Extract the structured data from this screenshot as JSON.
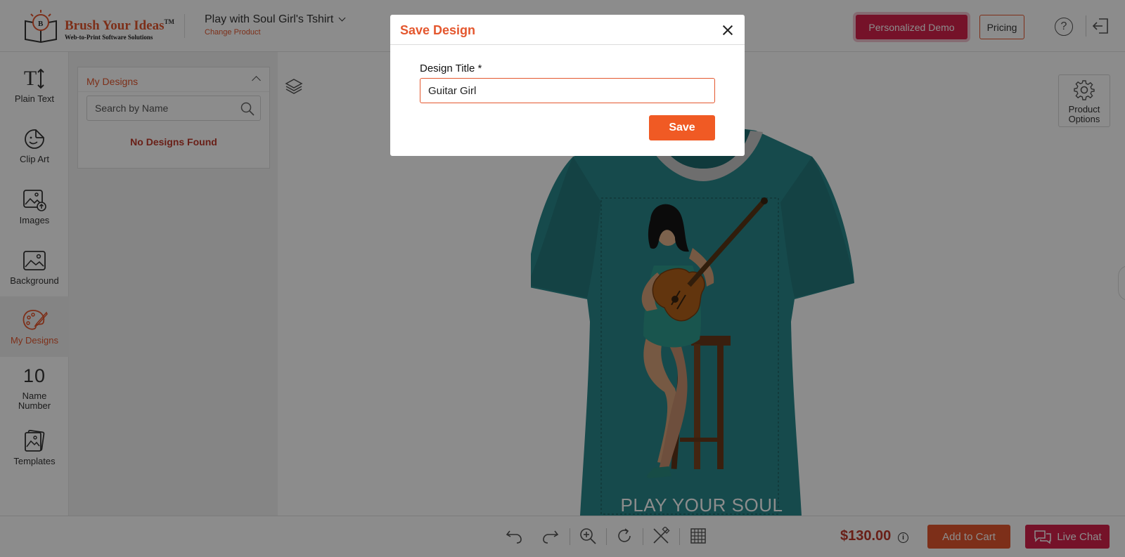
{
  "header": {
    "brand_name": "Brush Your Ideas",
    "brand_tm": "TM",
    "brand_tagline": "Web-to-Print Software Solutions",
    "product_name": "Play with Soul Girl's Tshirt",
    "change_product": "Change Product",
    "demo_label": "Personalized Demo",
    "pricing_label": "Pricing",
    "help_glyph": "?"
  },
  "sidebar": {
    "items": [
      {
        "label": "Plain Text",
        "icon": "text-icon"
      },
      {
        "label": "Clip Art",
        "icon": "clipart-icon"
      },
      {
        "label": "Images",
        "icon": "image-upload-icon"
      },
      {
        "label": "Background",
        "icon": "background-image-icon"
      },
      {
        "label": "My Designs",
        "icon": "palette-icon",
        "active": true
      },
      {
        "label": "Name Number",
        "icon": "name-number-icon"
      },
      {
        "label": "Templates",
        "icon": "templates-icon"
      }
    ],
    "text_glyph": "T",
    "number_glyph": "10"
  },
  "designs_panel": {
    "title": "My Designs",
    "search_placeholder": "Search by Name",
    "empty_message": "No Designs Found"
  },
  "canvas": {
    "product_options_label": "Product Options",
    "shirt_text": "PLAY YOUR SOUL",
    "shirt_color": "#29878a"
  },
  "footer": {
    "price": "$130.00",
    "info_glyph": "i",
    "add_to_cart": "Add to Cart",
    "live_chat": "Live Chat"
  },
  "modal": {
    "title": "Save Design",
    "field_label": "Design Title *",
    "field_value": "Guitar Girl",
    "save_label": "Save"
  },
  "colors": {
    "accent": "#e4572e",
    "demo": "#d6214c",
    "save": "#f05a24"
  }
}
